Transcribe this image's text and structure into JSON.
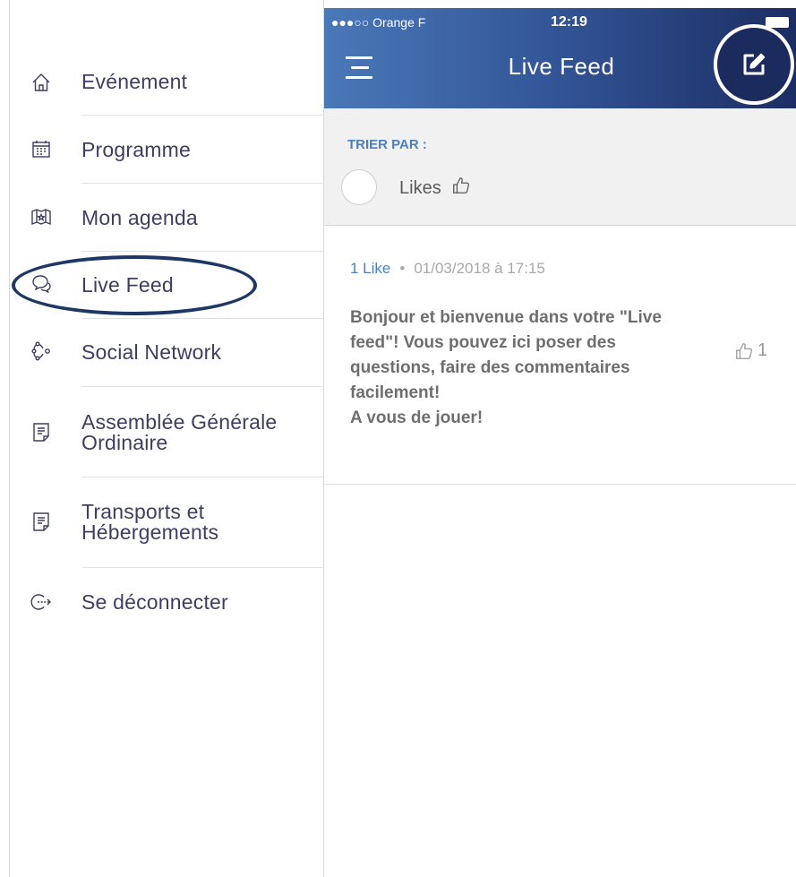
{
  "status_bar": {
    "carrier": "●●●○○ Orange F",
    "time": "12:19"
  },
  "header": {
    "title": "Live Feed"
  },
  "menu": {
    "items": [
      {
        "label": "Evénement",
        "icon": "home-icon"
      },
      {
        "label": "Programme",
        "icon": "calendar-icon"
      },
      {
        "label": "Mon agenda",
        "icon": "agenda-icon"
      },
      {
        "label": "Live Feed",
        "icon": "chat-bubbles-icon",
        "highlighted": true
      },
      {
        "label": "Social Network",
        "icon": "social-network-icon"
      },
      {
        "label": "Assemblée Générale Ordinaire",
        "label_lines": [
          "Assemblée Générale",
          "Ordinaire"
        ],
        "icon": "document-icon"
      },
      {
        "label": "Transports et Hébergements",
        "label_lines": [
          "Transports et",
          "Hébergements"
        ],
        "icon": "document-icon"
      },
      {
        "label": "Se déconnecter",
        "icon": "logout-icon"
      }
    ]
  },
  "sort": {
    "title": "TRIER PAR :",
    "option_label": "Likes",
    "option_icon": "thumbs-up-icon"
  },
  "post": {
    "like_count_label": "1 Like",
    "separator": "•",
    "date": "01/03/2018 à 17:15",
    "lines": [
      "Bonjour et bienvenue dans votre \"Live",
      "feed\"! Vous pouvez ici poser des",
      "questions, faire des commentaires",
      "facilement!",
      "A vous de jouer!"
    ],
    "likes": "1"
  },
  "colors": {
    "accent": "#4d7fbf",
    "header_dark": "#1c2d63",
    "highlight_ring": "#1e3866",
    "menu_text": "#3e3d63"
  }
}
